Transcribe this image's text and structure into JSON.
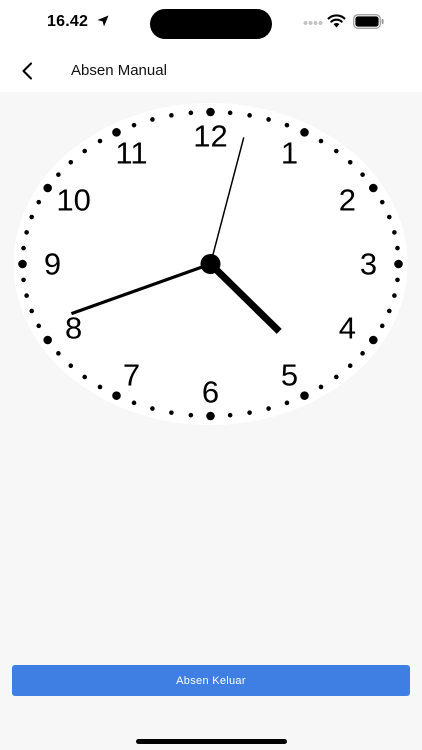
{
  "status_bar": {
    "time": "16.42",
    "icons": [
      "location-arrow-icon",
      "cellular-signal-icon",
      "wifi-icon",
      "battery-icon"
    ]
  },
  "header": {
    "back_icon": "chevron-left-icon",
    "title": "Absen Manual"
  },
  "clock": {
    "numerals": [
      "12",
      "1",
      "2",
      "3",
      "4",
      "5",
      "6",
      "7",
      "8",
      "9",
      "10",
      "11"
    ],
    "time": {
      "hour": 4,
      "minute": 41,
      "second": 2
    },
    "face_color": "#ffffff",
    "hand_color": "#000000"
  },
  "actions": {
    "checkout_label": "Absen Keluar",
    "accent_color": "#3f7fe4"
  }
}
